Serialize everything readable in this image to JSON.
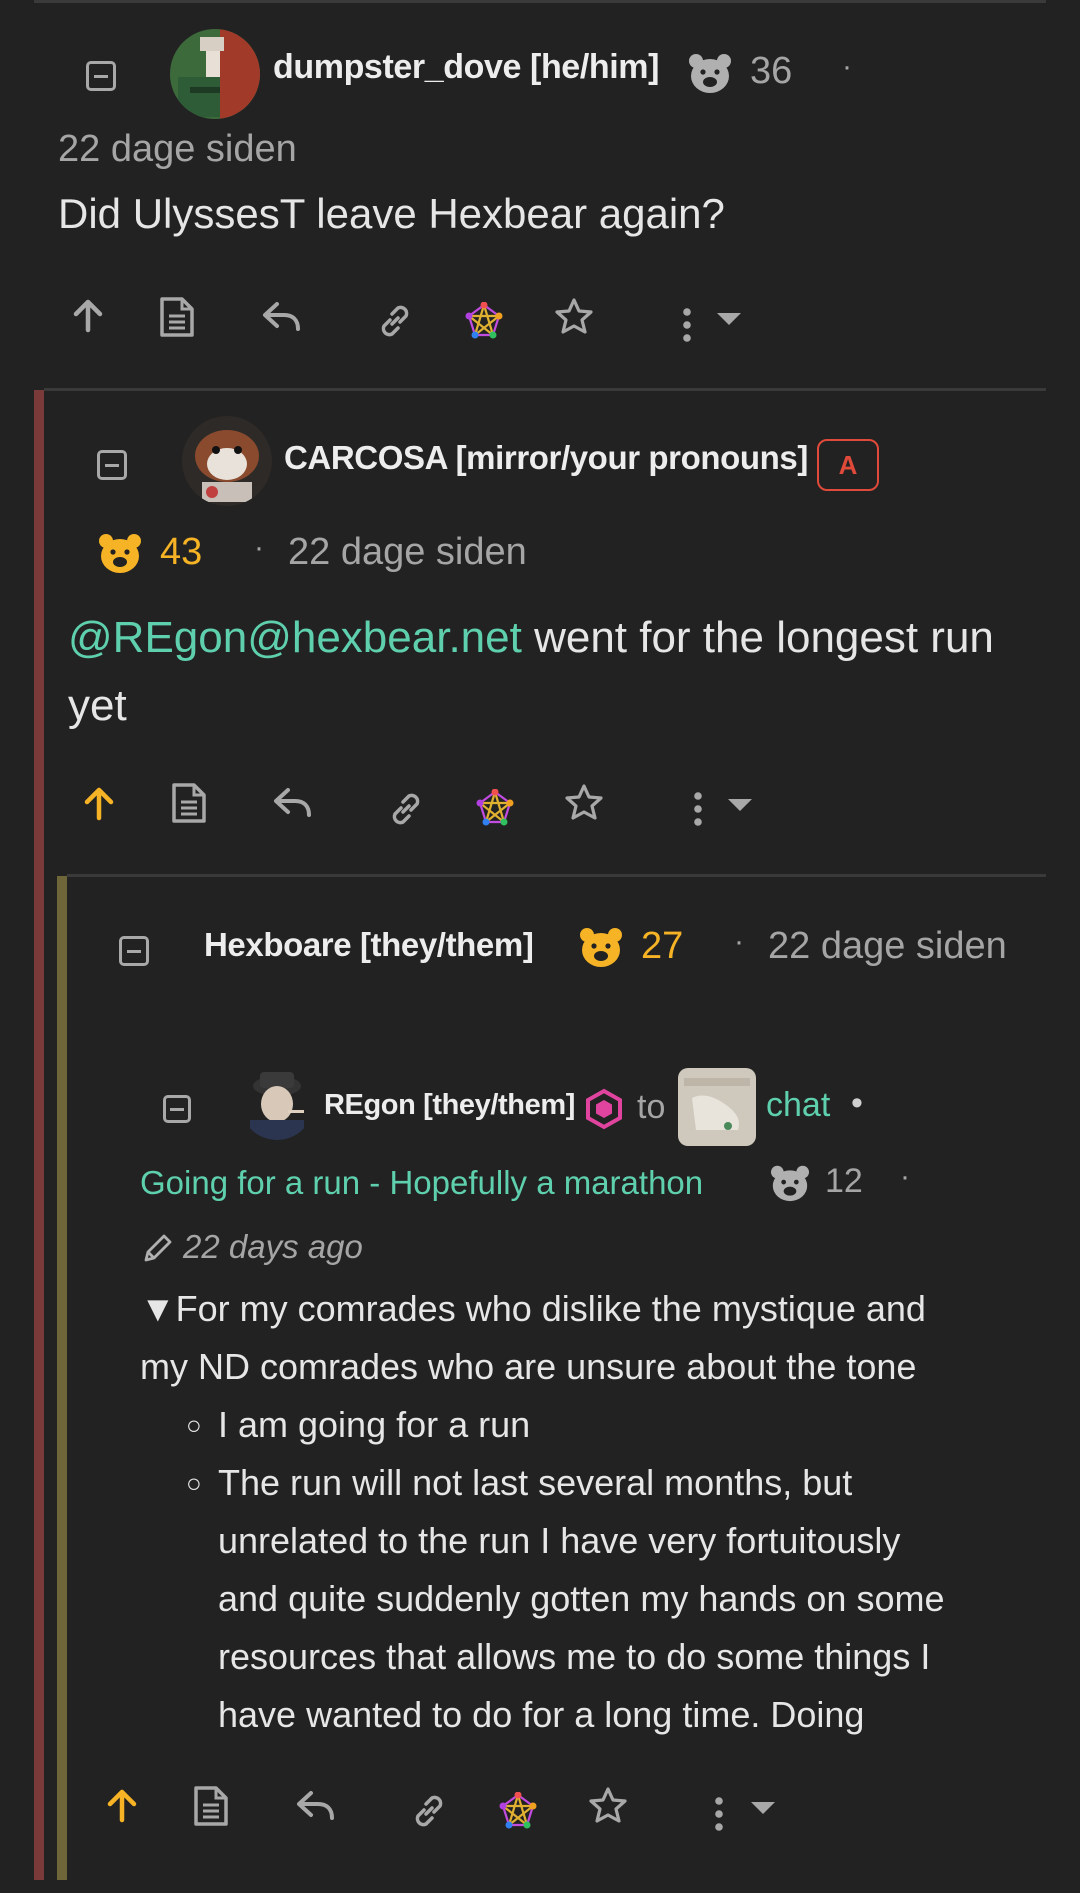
{
  "comments": [
    {
      "username": "dumpster_dove [he/him]",
      "score": "36",
      "time": "22 dage siden",
      "body": "Did UlyssesT leave Hexbear again?",
      "upvoted": false
    },
    {
      "username": "CARCOSA [mirror/your pronouns]",
      "badge": "A",
      "score": "43",
      "time": "22 dage siden",
      "mention": "@REgon@hexbear.net",
      "body_line1_rest": " went for the longest run",
      "body_line2": "yet",
      "upvoted": true
    },
    {
      "username": "Hexboare [they/them]",
      "score": "27",
      "time": "22 dage siden",
      "upvoted": true,
      "quoted_post": {
        "username": "REgon [they/them]",
        "to_label": "to",
        "community": "chat",
        "title": "Going for a run - Hopefully a marathon",
        "score": "12",
        "edited_time": "22 days ago",
        "spoiler_summary_line1": "For my comrades who dislike the mystique and",
        "spoiler_summary_line2": "my ND comrades who are unsure about the tone",
        "spoiler_marker": "▼",
        "items": [
          "I am going for a run",
          "The run will not last several months, but"
        ],
        "item2_continued": [
          "unrelated to the run I have very fortuitously",
          "and quite suddenly gotten my hands on some",
          "resources that allows me to do some things I",
          "have wanted to do for a long time. Doing"
        ]
      }
    }
  ],
  "colors": {
    "background": "#222222",
    "accent_upvote": "#f5b325",
    "link": "#5fd0ad",
    "thread_bar_1": "#7a3a3a",
    "thread_bar_2": "#6e6638",
    "admin": "#e04a3a",
    "mod_badge": "#e0449e"
  },
  "icons": [
    "collapse-icon",
    "bear-icon",
    "upvote-icon",
    "source-icon",
    "reply-icon",
    "link-icon",
    "fediverse-icon",
    "star-icon",
    "more-icon",
    "dropdown-icon",
    "edit-icon"
  ]
}
